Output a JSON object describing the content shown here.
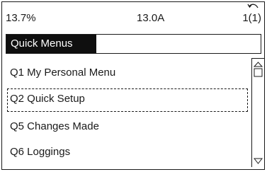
{
  "status": {
    "percent": "13.7%",
    "current": "13.0A",
    "page": "1(1)"
  },
  "title": "Quick Menus",
  "items": [
    "Q1 My Personal Menu",
    "Q2 Quick Setup",
    "Q5 Changes Made",
    "Q6 Loggings"
  ],
  "selected_index": 1,
  "icons": {
    "back": "back-arrow-icon",
    "scroll_up": "scroll-up-icon",
    "scroll_down": "scroll-down-icon"
  }
}
